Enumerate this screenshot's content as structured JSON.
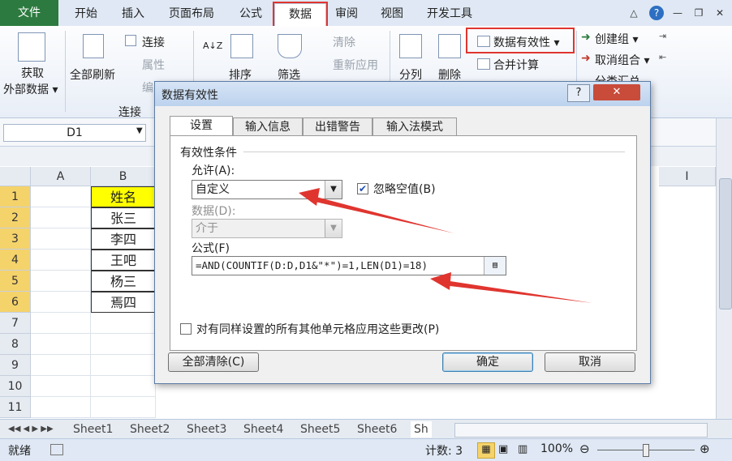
{
  "ribbon_tabs": [
    "文件",
    "开始",
    "插入",
    "页面布局",
    "公式",
    "数据",
    "审阅",
    "视图",
    "开发工具"
  ],
  "window_controls": {
    "minimize": "△",
    "help": "?",
    "restore": "—",
    "maximize": "❐",
    "close": "✕"
  },
  "ribbon": {
    "get_external": [
      "获取",
      "外部数据 ▾"
    ],
    "refresh_all": "全部刷新",
    "connections": "连接",
    "properties": "属性",
    "edit_links": "编",
    "group_connections": "连接",
    "sort_az": "A↓Z",
    "sort": "排序",
    "filter": "筛选",
    "clear": "清除",
    "reapply": "重新应用",
    "split": "分列",
    "remove_dup": "删除",
    "data_validation": "数据有效性 ▾",
    "consolidate": "合并计算",
    "group": "创建组 ▾",
    "ungroup": "取消组合 ▾",
    "subtotal": "分类汇总"
  },
  "name_box": "D1",
  "columns": [
    "A",
    "B",
    "I"
  ],
  "rows": [
    "1",
    "2",
    "3",
    "4",
    "5",
    "6",
    "7",
    "8",
    "9",
    "10",
    "11"
  ],
  "cells_b": [
    "姓名",
    "张三",
    "李四",
    "王吧",
    "杨三",
    "焉四"
  ],
  "sheets": [
    "Sheet1",
    "Sheet2",
    "Sheet3",
    "Sheet4",
    "Sheet5",
    "Sheet6",
    "Sh"
  ],
  "status": {
    "ready": "就绪",
    "count": "计数: 3",
    "zoom": "100%"
  },
  "dialog": {
    "title": "数据有效性",
    "help": "?",
    "close": "✕",
    "tabs": [
      "设置",
      "输入信息",
      "出错警告",
      "输入法模式"
    ],
    "section": "有效性条件",
    "allow_label": "允许(A):",
    "allow_value": "自定义",
    "ignore_blank": "忽略空值(B)",
    "data_label": "数据(D):",
    "data_value": "介于",
    "formula_label": "公式(F)",
    "formula_value": "=AND(COUNTIF(D:D,D1&\"*\")=1,LEN(D1)=18)",
    "apply_all": "对有同样设置的所有其他单元格应用这些更改(P)",
    "clear_all": "全部清除(C)",
    "ok": "确定",
    "cancel": "取消"
  },
  "colors": {
    "accent_red": "#e0352f",
    "file_tab": "#2c7a3f",
    "header_yellow": "#ffff00"
  }
}
